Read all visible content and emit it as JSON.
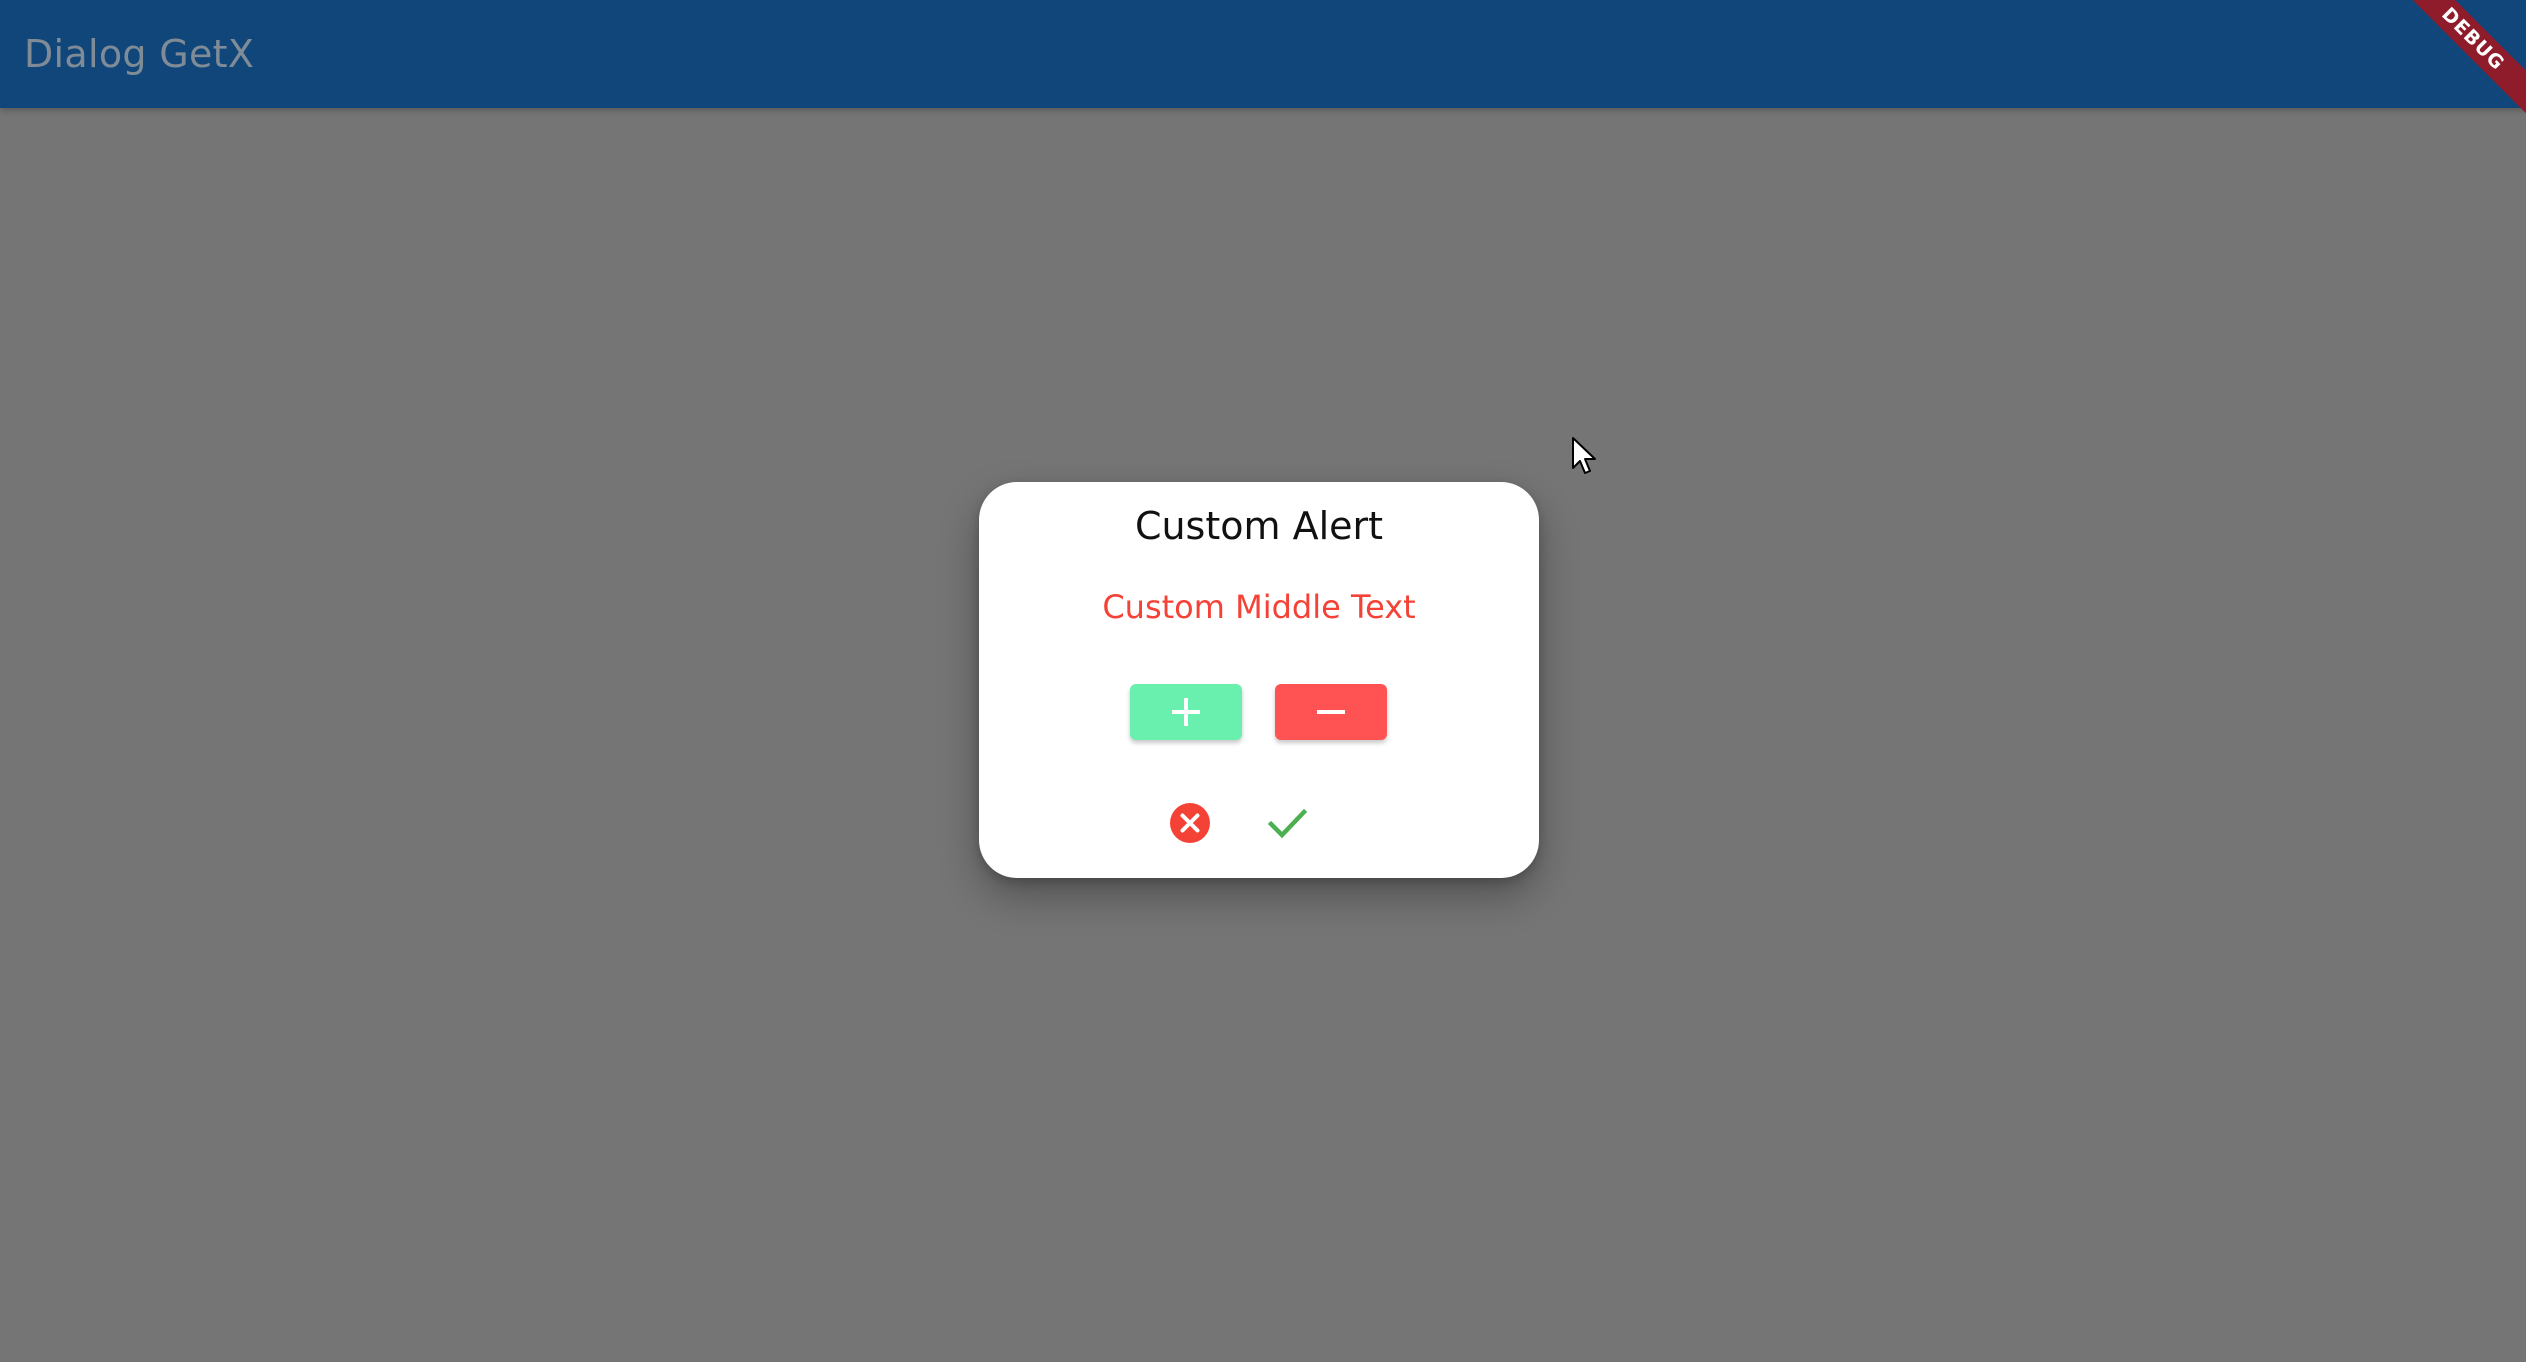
{
  "app_bar": {
    "title": "Dialog GetX",
    "background": "#10467A",
    "debug_banner": "DEBUG"
  },
  "overlay": {
    "background": "#757575"
  },
  "dialog": {
    "title": "Custom Alert",
    "middle_text": "Custom Middle Text",
    "middle_text_color": "#F44336",
    "buttons": [
      {
        "icon": "plus-icon",
        "color": "#69F0AE"
      },
      {
        "icon": "minus-icon",
        "color": "#FF5252"
      }
    ],
    "actions": [
      {
        "icon": "cancel-circle-icon",
        "color": "#F44336"
      },
      {
        "icon": "check-icon",
        "color": "#4CAF50"
      }
    ]
  }
}
